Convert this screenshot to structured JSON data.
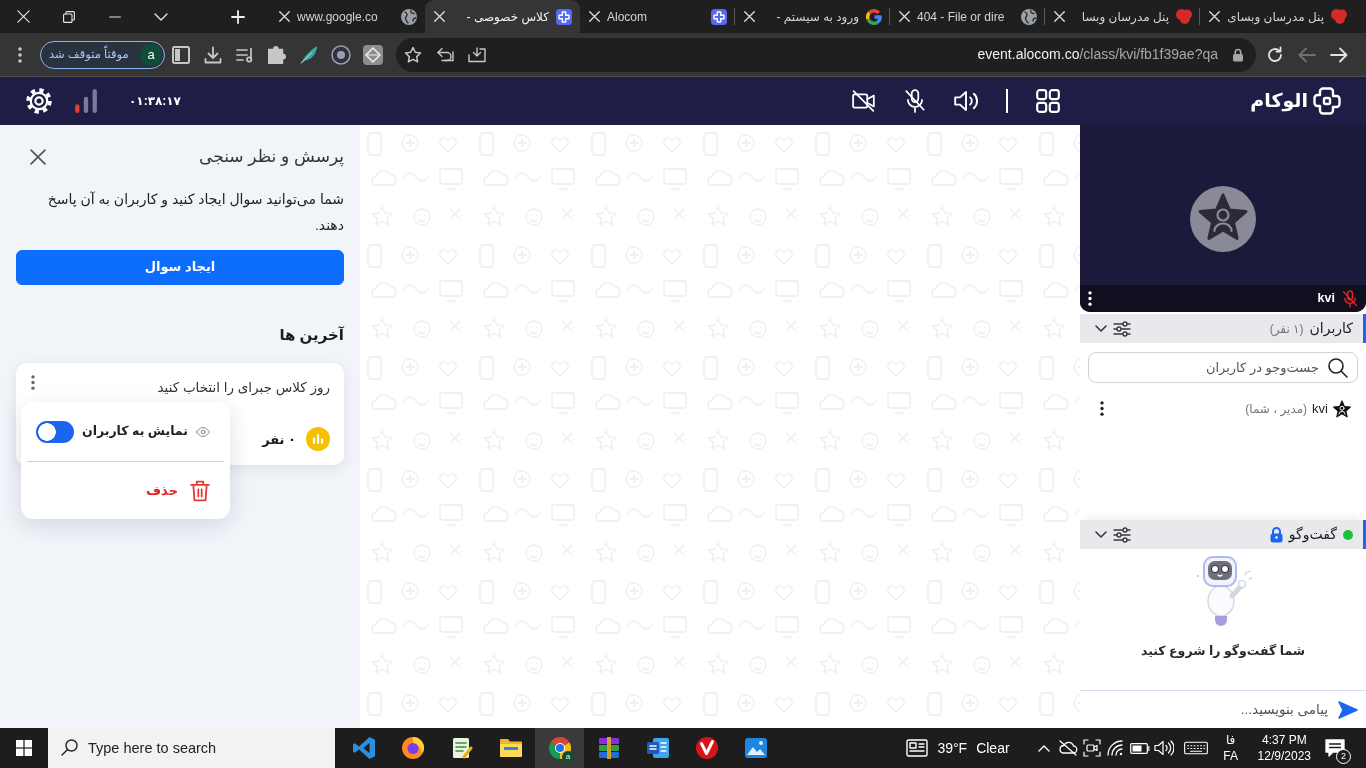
{
  "browser": {
    "tabs": [
      {
        "title": "پنل مدرسان وبسای",
        "kind": "flower",
        "selected": false
      },
      {
        "title": "پنل مدرسان وبسا",
        "kind": "flower",
        "selected": false
      },
      {
        "title": "404 - File or dire",
        "kind": "globe",
        "selected": false
      },
      {
        "title": "ورود به سیستم -",
        "kind": "google",
        "selected": false
      },
      {
        "title": "Alocom",
        "kind": "knot",
        "selected": false
      },
      {
        "title": "کلاس خصوصی -",
        "kind": "knot",
        "selected": true
      },
      {
        "title": "www.google.co",
        "kind": "globe",
        "selected": false
      }
    ],
    "toolbar": {
      "back_disabled": false,
      "forward_disabled": true
    },
    "profile": {
      "initial": "a",
      "status": "موقتاً متوقف شد"
    },
    "address": {
      "host": "event.alocom.co",
      "path": "/class/kvi/fb1f39ae?qa"
    }
  },
  "app_header": {
    "brand": "الوکام",
    "camera_on": false,
    "mic_on": false,
    "speaker_on": true,
    "timer": "۰۱:۳۸:۱۷"
  },
  "video": {
    "participant": "kvi",
    "mic_muted": true
  },
  "users": {
    "title": "کاربران",
    "count": "(۱ نفر)",
    "expanded": true,
    "search_placeholder": "جست‌وجو در کاربران",
    "list": [
      {
        "name": "kvi",
        "role": "(مدیر ، شما)"
      }
    ]
  },
  "chat": {
    "title": "گفت‌وگو",
    "online": true,
    "locked": true,
    "expanded": true,
    "empty_text": "شما گفت‌وگو را شروع کنید",
    "placeholder": "پیامی بنویسید..."
  },
  "poll_panel": {
    "title": "پرسش و نظر سنجی",
    "description": "شما می‌توانید سوال ایجاد کنید و کاربران به آن پاسخ دهند.",
    "create_button": "ایجاد سوال",
    "recent_heading": "آخرین ها",
    "polls": [
      {
        "question": "روز کلاس جبرای را انتخاب کنید",
        "responses": "۰ نفر"
      }
    ],
    "context_menu": [
      {
        "kind": "toggle",
        "label": "نمایش به کاربران",
        "checked": true
      },
      {
        "kind": "delete",
        "label": "حذف"
      }
    ]
  },
  "taskbar": {
    "search_placeholder": "Type here to search",
    "apps": [
      {
        "kind": "ribbon",
        "active": false
      },
      {
        "kind": "fox",
        "active": false
      },
      {
        "kind": "notepad",
        "active": false
      },
      {
        "kind": "folder",
        "active": false
      },
      {
        "kind": "browser",
        "active": true,
        "badge": "a"
      },
      {
        "kind": "books",
        "active": false
      },
      {
        "kind": "document",
        "active": false
      },
      {
        "kind": "checkdisc",
        "active": false
      },
      {
        "kind": "photos",
        "active": false
      }
    ],
    "weather": {
      "temperature": "39°F",
      "condition": "Clear"
    },
    "language": {
      "native": "فا",
      "code": "FA"
    },
    "time": "4:37 PM",
    "date": "12/9/2023",
    "notifications": "2"
  }
}
